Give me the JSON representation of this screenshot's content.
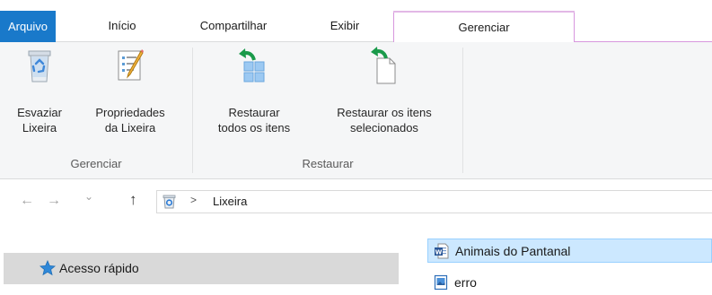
{
  "ribbon_tabs": {
    "file": "Arquivo",
    "home": "Início",
    "share": "Compartilhar",
    "view": "Exibir",
    "manage": "Gerenciar"
  },
  "ribbon": {
    "manage_group": {
      "label": "Gerenciar",
      "empty_bin": [
        "Esvaziar",
        "Lixeira"
      ],
      "bin_properties": [
        "Propriedades",
        "da Lixeira"
      ]
    },
    "restore_group": {
      "label": "Restaurar",
      "restore_all": [
        "Restaurar",
        "todos os itens"
      ],
      "restore_selected": [
        "Restaurar os itens",
        "selecionados"
      ]
    }
  },
  "address_bar": {
    "path_separator": ">",
    "location": "Lixeira",
    "icon": "recycle-bin-icon"
  },
  "navigation": {
    "back_icon": "←",
    "forward_icon": "→",
    "recent_icon": "⌄",
    "up_icon": "↑"
  },
  "nav_pane": {
    "quick_access": "Acesso rápido",
    "quick_access_icon": "star-icon"
  },
  "files": [
    {
      "name": "Animais do Pantanal",
      "icon": "word-document-icon",
      "selected": true
    },
    {
      "name": "erro",
      "icon": "image-file-icon",
      "selected": false
    }
  ],
  "colors": {
    "file_tab": "#1979ca",
    "context_tab_border": "#d797de",
    "selection_bg": "#cce8ff",
    "selection_border": "#99d1ff",
    "restore_arrow": "#1a9a4a"
  }
}
